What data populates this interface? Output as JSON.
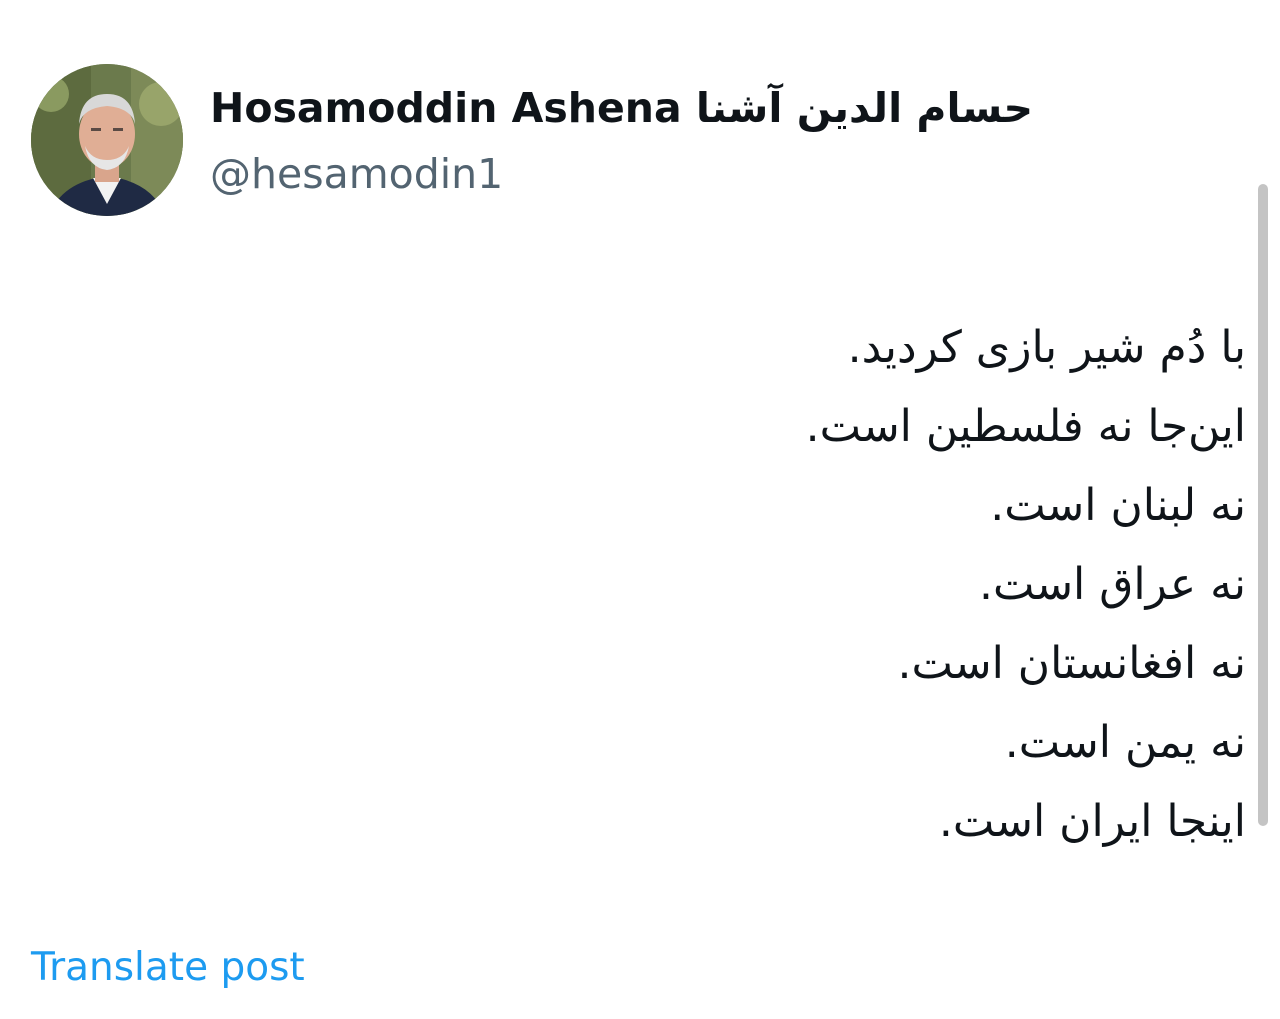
{
  "author": {
    "display_name": "Hosamoddin Ashena حسام الدین آشنا",
    "handle": "@hesamodin1"
  },
  "post": {
    "lines": [
      "با دُم شیر بازی کردید.",
      "این‌جا نه فلسطین است.",
      "نه لبنان است.",
      "نه عراق است.",
      "نه افغانستان است.",
      "نه یمن است.",
      "اینجا ایران است."
    ]
  },
  "actions": {
    "translate_label": "Translate post"
  },
  "colors": {
    "text": "#0f1419",
    "handle": "#536471",
    "link": "#1d9bf0",
    "scrollbar": "#c4c4c4"
  }
}
